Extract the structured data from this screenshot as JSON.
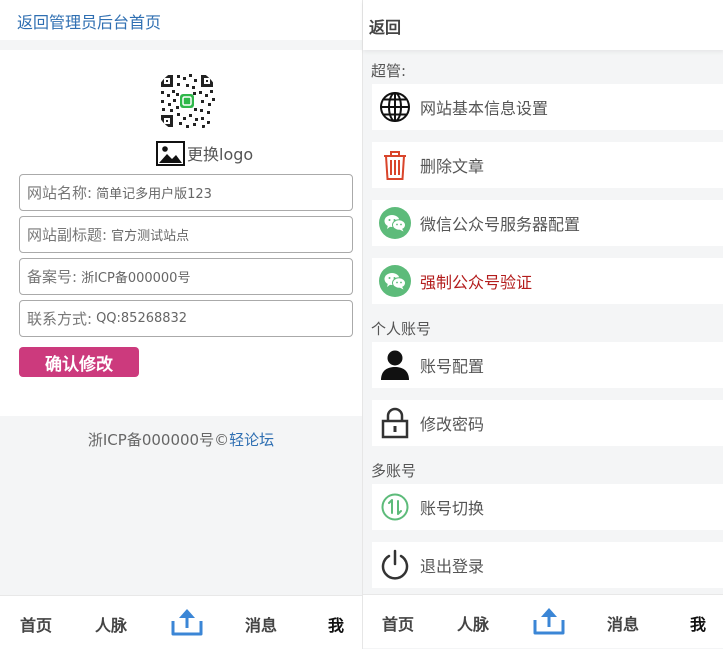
{
  "left": {
    "header": {
      "back_link": "返回管理员后台首页"
    },
    "logo": {
      "change_label": "更换logo"
    },
    "form": {
      "fields": [
        {
          "label": "网站名称:",
          "value": "简单记多用户版123"
        },
        {
          "label": "网站副标题:",
          "value": "官方测试站点"
        },
        {
          "label": "备案号:",
          "value": "浙ICP备000000号"
        },
        {
          "label": "联系方式:",
          "value": "QQ:85268832"
        }
      ],
      "submit_label": "确认修改"
    },
    "footer": {
      "icp": "浙ICP备000000号©",
      "forum_link": "轻论坛"
    }
  },
  "right": {
    "header": {
      "back_label": "返回"
    },
    "sections": {
      "super": "超管:",
      "personal": "个人账号",
      "multi": "多账号"
    },
    "menu": {
      "site_info": "网站基本信息设置",
      "delete_article": "删除文章",
      "wechat_server": "微信公众号服务器配置",
      "force_verify": "强制公众号验证",
      "account_config": "账号配置",
      "change_password": "修改密码",
      "switch_account": "账号切换",
      "logout": "退出登录"
    }
  },
  "nav": {
    "home": "首页",
    "contacts": "人脉",
    "messages": "消息",
    "me": "我"
  },
  "colors": {
    "link_blue": "#2f6fb2",
    "confirm_button": "#cc3a7d",
    "wechat_green": "#5dbb7a",
    "warning_red": "#b31c1c",
    "delete_icon_red": "#d9452b",
    "upload_icon_blue": "#3b86d6"
  }
}
